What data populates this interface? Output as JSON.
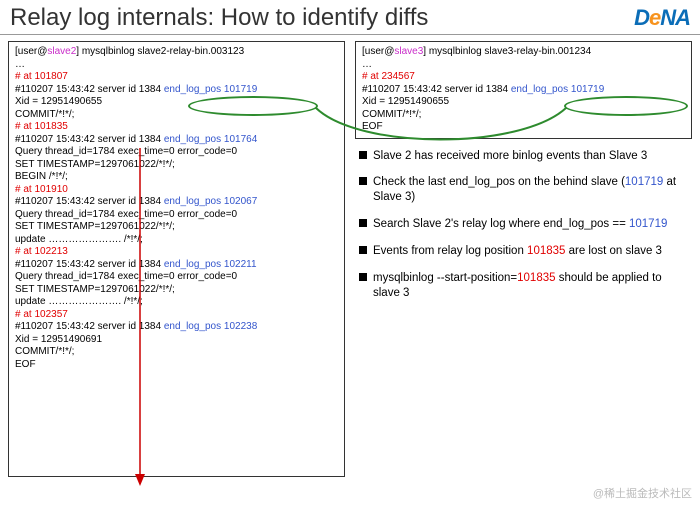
{
  "title": "Relay log internals: How to identify diffs",
  "logo": {
    "d": "D",
    "e": "e",
    "n": "N",
    "a": "A"
  },
  "left": {
    "prompt_user": "user",
    "prompt_at": "@",
    "prompt_host": "slave2",
    "prompt_cmd": "] mysqlbinlog slave2-relay-bin.003123",
    "ellipsis": "…",
    "l1": "# at 101807",
    "l2a": "#110207 15:43:42 server id 1384  ",
    "l2b": "end_log_pos 101719",
    "l3": "Xid = 12951490655",
    "l4": "COMMIT/*!*/;",
    "l5": "# at 101835",
    "l6a": "#110207 15:43:42 server id 1384  ",
    "l6b": "end_log_pos 101764",
    "l7": "Query thread_id=1784 exec_time=0 error_code=0",
    "l8": "SET TIMESTAMP=1297061022/*!*/;",
    "l9": "BEGIN /*!*/;",
    "l10": "# at 101910",
    "l11a": "#110207 15:43:42 server id 1384  ",
    "l11b": "end_log_pos 102067",
    "l12": "Query thread_id=1784 exec_time=0 error_code=0",
    "l13": "SET TIMESTAMP=1297061022/*!*/;",
    "l14": "update …………………. /*!*/;",
    "l15": "# at 102213",
    "l16a": "#110207 15:43:42 server id 1384  ",
    "l16b": "end_log_pos 102211",
    "l17": "Query thread_id=1784 exec_time=0 error_code=0",
    "l18": "SET TIMESTAMP=1297061022/*!*/;",
    "l19": "update …………………. /*!*/;",
    "l20": "# at 102357",
    "l21a": "#110207 15:43:42 server id 1384  ",
    "l21b": "end_log_pos 102238",
    "l22": "Xid = 12951490691",
    "l23": "COMMIT/*!*/;",
    "l24": "EOF"
  },
  "right": {
    "prompt_user": "user",
    "prompt_at": "@",
    "prompt_host": "slave3",
    "prompt_cmd": "] mysqlbinlog slave3-relay-bin.001234",
    "ellipsis": "…",
    "l1": "# at 234567",
    "l2a": "#110207 15:43:42 server id 1384  ",
    "l2b": "end_log_pos 101719",
    "l3": "Xid = 12951490655",
    "l4": "COMMIT/*!*/;",
    "l5": "EOF"
  },
  "bullets": {
    "b1": "Slave 2 has received more binlog events than Slave 3",
    "b2a": "Check the last end_log_pos on the behind slave (",
    "b2b": "101719",
    "b2c": " at Slave 3)",
    "b3a": "Search Slave 2's relay log where end_log_pos == ",
    "b3b": "101719",
    "b4a": "Events from relay log position ",
    "b4b": "101835",
    "b4c": " are lost on slave 3",
    "b5a": "mysqlbinlog --start-position=",
    "b5b": "101835",
    "b5c": " should be applied to slave 3"
  },
  "watermark": "@稀土掘金技术社区"
}
